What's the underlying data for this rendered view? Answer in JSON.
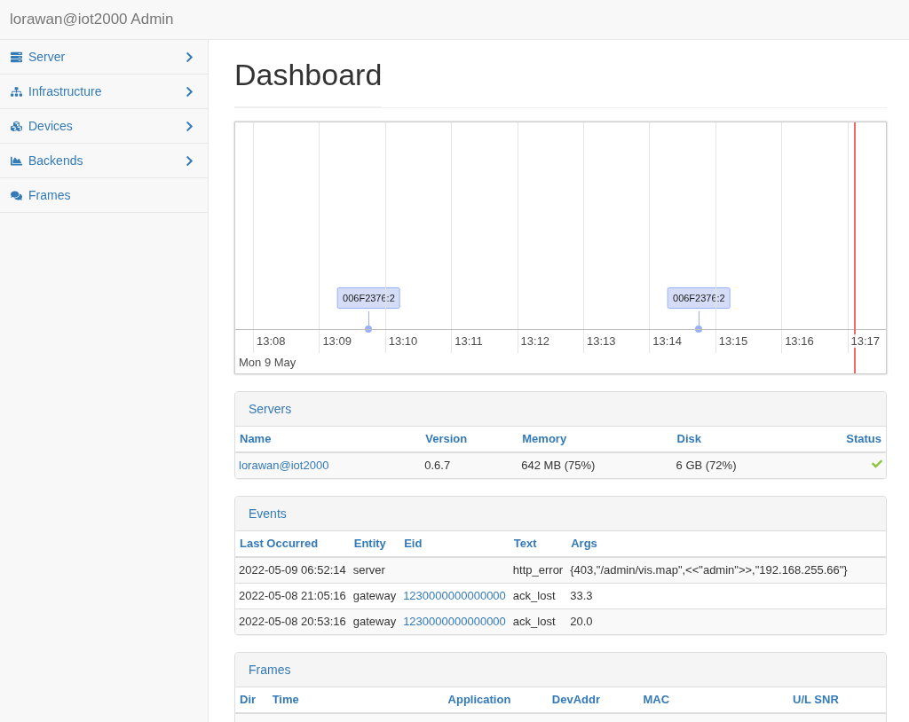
{
  "header": {
    "title": "lorawan@iot2000 Admin"
  },
  "sidebar": {
    "items": [
      {
        "label": "Server",
        "has_submenu": true
      },
      {
        "label": "Infrastructure",
        "has_submenu": true
      },
      {
        "label": "Devices",
        "has_submenu": true
      },
      {
        "label": "Backends",
        "has_submenu": true
      },
      {
        "label": "Frames",
        "has_submenu": false
      }
    ]
  },
  "page_title": "Dashboard",
  "timeline": {
    "ticks": [
      {
        "label": "13:08"
      },
      {
        "label": "13:09",
        "items": [
          {
            "label": "006F2376:2"
          }
        ]
      },
      {
        "label": "13:10"
      },
      {
        "label": "13:11"
      },
      {
        "label": "13:12"
      },
      {
        "label": "13:13"
      },
      {
        "label": "13:14",
        "items": [
          {
            "label": "006F2376:2"
          }
        ]
      },
      {
        "label": "13:15"
      },
      {
        "label": "13:16"
      },
      {
        "label": "13:17"
      }
    ],
    "date": "Mon 9 May"
  },
  "servers": {
    "title": "Servers",
    "columns": [
      "Name",
      "Version",
      "Memory",
      "Disk",
      "Status"
    ],
    "rows": [
      {
        "name": "lorawan@iot2000",
        "version": "0.6.7",
        "memory": "642 MB (75%)",
        "disk": "6 GB (72%)",
        "ok": true
      }
    ]
  },
  "events": {
    "title": "Events",
    "columns": [
      "Last Occurred",
      "Entity",
      "Eid",
      "Text",
      "Args"
    ],
    "rows": [
      {
        "last_occurred": "2022-05-09 06:52:14",
        "entity": "server",
        "eid": "",
        "text": "http_error",
        "args": "{403,\"/admin/vis.map\",<<\"admin\">>,\"192.168.255.66\"}"
      },
      {
        "last_occurred": "2022-05-08 21:05:16",
        "entity": "gateway",
        "eid": "1230000000000000",
        "text": "ack_lost",
        "args": "33.3"
      },
      {
        "last_occurred": "2022-05-08 20:53:16",
        "entity": "gateway",
        "eid": "1230000000000000",
        "text": "ack_lost",
        "args": "20.0"
      }
    ]
  },
  "frames": {
    "title": "Frames",
    "columns": [
      "Dir",
      "Time",
      "Application",
      "DevAddr",
      "MAC",
      "U/L SNR"
    ]
  }
}
